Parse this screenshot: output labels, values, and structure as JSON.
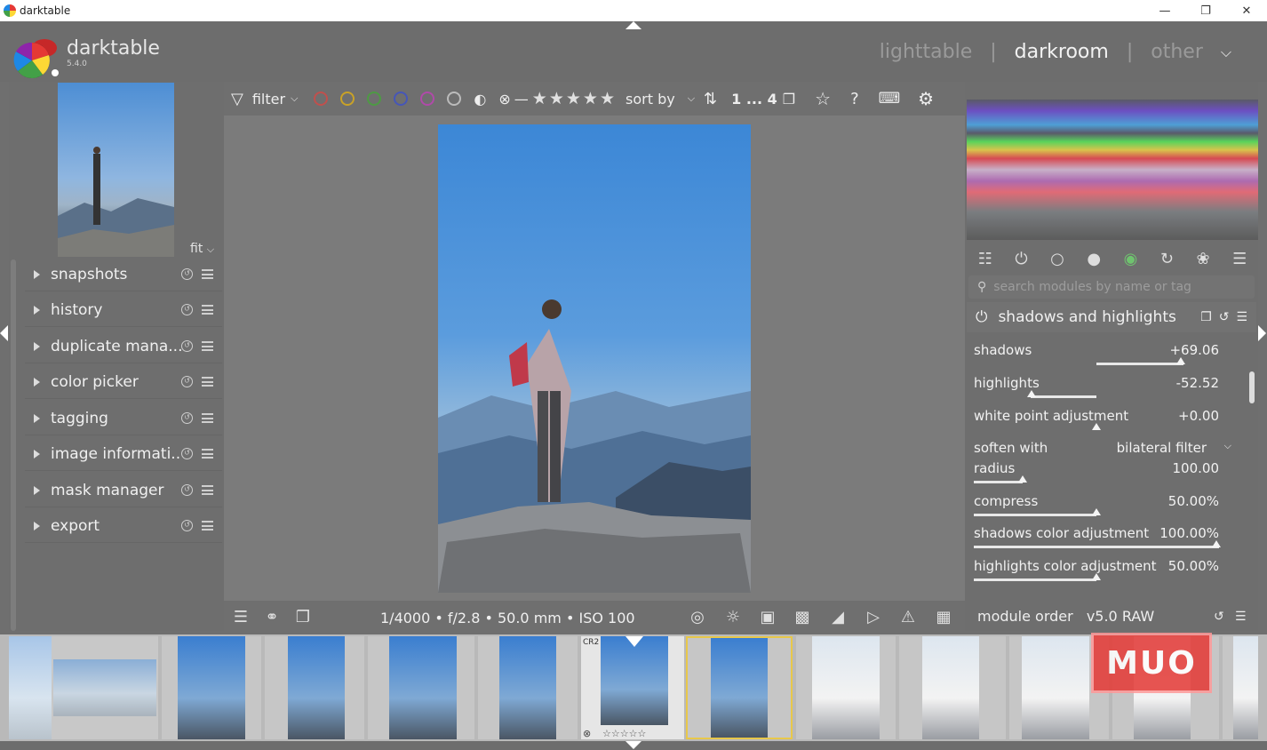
{
  "window": {
    "title": "darktable",
    "controls": [
      "—",
      "❐",
      "✕"
    ]
  },
  "brand": {
    "name": "darktable",
    "version": "5.4.0"
  },
  "views": {
    "lighttable": "lighttable",
    "darkroom": "darkroom",
    "other": "other",
    "sep": "|"
  },
  "left": {
    "fit": "fit",
    "modules": [
      {
        "label": "snapshots"
      },
      {
        "label": "history"
      },
      {
        "label": "duplicate mana..."
      },
      {
        "label": "color picker"
      },
      {
        "label": "tagging"
      },
      {
        "label": "image informati..."
      },
      {
        "label": "mask manager"
      },
      {
        "label": "export"
      }
    ]
  },
  "toolbar": {
    "filter": "filter",
    "sort_by": "sort by",
    "count": "1 ... 4",
    "color_labels": [
      "#c0504d",
      "#c9a227",
      "#4e9a44",
      "#4656b8",
      "#b04aa9"
    ]
  },
  "bottom": {
    "exif": "1/4000 • f/2.8 • 50.0 mm • ISO 100"
  },
  "right": {
    "search_placeholder": "search modules by name or tag",
    "module_title": "shadows and highlights",
    "params": [
      {
        "label": "shadows",
        "value": "+69.06"
      },
      {
        "label": "highlights",
        "value": "-52.52"
      },
      {
        "label": "white point adjustment",
        "value": "+0.00"
      },
      {
        "label": "soften with",
        "value": "bilateral filter"
      },
      {
        "label": "radius",
        "value": "100.00"
      },
      {
        "label": "compress",
        "value": "50.00%"
      },
      {
        "label": "shadows color adjustment",
        "value": "100.00%"
      },
      {
        "label": "highlights color adjustment",
        "value": "50.00%"
      }
    ],
    "module_order_label": "module order",
    "module_order_value": "v5.0 RAW"
  },
  "filmstrip": {
    "cr2_badge": "CR2",
    "stars": "☆☆☆☆☆"
  },
  "watermark": "MUO"
}
